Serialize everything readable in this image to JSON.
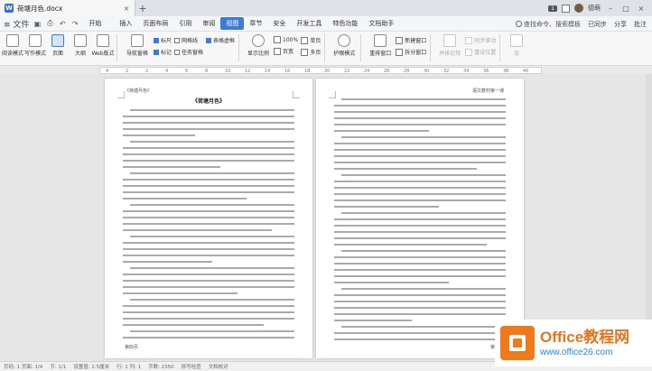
{
  "titlebar": {
    "doc_name": "荷塘月色.docx",
    "close_glyph": "×",
    "add_glyph": "+",
    "badge": "1",
    "user": "德萌",
    "min_glyph": "–",
    "max_glyph": "□",
    "closewin_glyph": "×"
  },
  "menubar": {
    "menu_label": "≡ 文件",
    "start": "开始",
    "items": [
      "插入",
      "页面布局",
      "引用",
      "审阅",
      "视图",
      "章节",
      "安全",
      "开发工具",
      "特色功能",
      "文档助手"
    ],
    "active_index": 4,
    "search_label": "查找命令、搜索模板",
    "sync": "已同步",
    "share": "分享",
    "comment": "批注"
  },
  "ribbon": {
    "read_mode": "阅读模式",
    "write_mode": "写作模式",
    "page": "页面",
    "outline": "大纲",
    "web": "Web版式",
    "nav_pane": "导航窗格",
    "ruler": "标尺",
    "gridlines": "网格线",
    "table_lines": "表格虚框",
    "mark": "标记",
    "task_pane": "任务窗格",
    "zoom": "显示比例",
    "zoom_100": "100%",
    "single_page": "单页",
    "page_width": "页宽",
    "multi_page": "多页",
    "eye_mode": "护眼模式",
    "rearrange": "重排窗口",
    "new_window": "新建窗口",
    "split_window": "拆分窗口",
    "side_compare": "并排比较",
    "sync_scroll": "同步滚动",
    "reset_pos": "重设位置",
    "macro": "宏"
  },
  "ruler_ticks": [
    "4",
    "2",
    "2",
    "4",
    "6",
    "8",
    "10",
    "12",
    "14",
    "16",
    "18",
    "20",
    "22",
    "24",
    "26",
    "28",
    "30",
    "32",
    "34",
    "36",
    "38",
    "40"
  ],
  "pages": {
    "left_header": "《荷塘月色》",
    "left_title": "《荷塘月色》",
    "left_footer_left": "第四页",
    "right_header": "语文教材第一课",
    "right_footer_right": "第一课"
  },
  "statusbar": {
    "page_info": "页码: 1  页面: 1/4",
    "section": "节: 1/1",
    "position": "设置值: 2.5厘米",
    "row": "行: 1  列: 1",
    "words": "字数: 2350",
    "spell": "拼写检查",
    "doc_check": "文档校对"
  },
  "watermark": {
    "site": "Office教程网",
    "url": "www.office26.com"
  }
}
